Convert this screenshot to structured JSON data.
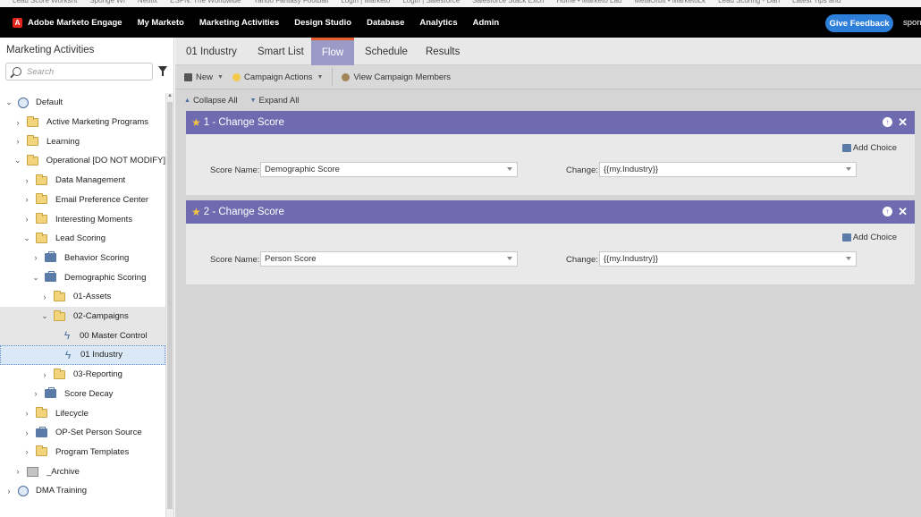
{
  "bookmarks": [
    "Lead Score Worksht",
    "Sponge WI",
    "Netflix",
    "ESPN: The Worldwide",
    "Yahoo Fantasy Football",
    "Login | Marketo",
    "Login | Salesforce",
    "Salesforce Stack Exch",
    "Home • Marketo Lau",
    "MetaOrbit • MarketoLk",
    "Lead Scoring - Dan",
    "Latest Tips and"
  ],
  "topnav": {
    "brand": "Adobe Marketo Engage",
    "links": [
      "My Marketo",
      "Marketing Activities",
      "Design Studio",
      "Database",
      "Analytics",
      "Admin"
    ],
    "feedback": "Give Feedback",
    "user": "spong"
  },
  "sidebar": {
    "title": "Marketing Activities",
    "search_placeholder": "Search",
    "tree": [
      {
        "label": "Default",
        "level": 0,
        "icon": "globe",
        "chev": "v"
      },
      {
        "label": "Active Marketing Programs",
        "level": 1,
        "icon": "folder",
        "chev": ">"
      },
      {
        "label": "Learning",
        "level": 1,
        "icon": "folder",
        "chev": ">"
      },
      {
        "label": "Operational [DO NOT MODIFY]",
        "level": 1,
        "icon": "folder",
        "chev": "v"
      },
      {
        "label": "Data Management",
        "level": 2,
        "icon": "folder",
        "chev": ">"
      },
      {
        "label": "Email Preference Center",
        "level": 2,
        "icon": "folder",
        "chev": ">"
      },
      {
        "label": "Interesting Moments",
        "level": 2,
        "icon": "folder",
        "chev": ">"
      },
      {
        "label": "Lead Scoring",
        "level": 2,
        "icon": "folder",
        "chev": "v"
      },
      {
        "label": "Behavior Scoring",
        "level": 3,
        "icon": "program",
        "chev": ">"
      },
      {
        "label": "Demographic Scoring",
        "level": 3,
        "icon": "program",
        "chev": "v"
      },
      {
        "label": "01-Assets",
        "level": 4,
        "icon": "folder",
        "chev": ">"
      },
      {
        "label": "02-Campaigns",
        "level": 4,
        "icon": "folder",
        "chev": "v",
        "state": "hl"
      },
      {
        "label": "00 Master Control",
        "level": 5,
        "icon": "bolt",
        "chev": "",
        "state": "hl"
      },
      {
        "label": "01 Industry",
        "level": 5,
        "icon": "bolt",
        "chev": "",
        "state": "sel"
      },
      {
        "label": "03-Reporting",
        "level": 4,
        "icon": "folder",
        "chev": ">"
      },
      {
        "label": "Score Decay",
        "level": 3,
        "icon": "program",
        "chev": ">"
      },
      {
        "label": "Lifecycle",
        "level": 2,
        "icon": "folder",
        "chev": ">"
      },
      {
        "label": "OP-Set Person Source",
        "level": 2,
        "icon": "program",
        "chev": ">"
      },
      {
        "label": "Program Templates",
        "level": 2,
        "icon": "folder",
        "chev": ">"
      },
      {
        "label": "_Archive",
        "level": 1,
        "icon": "archive",
        "chev": ">"
      },
      {
        "label": "DMA Training",
        "level": 0,
        "icon": "globe",
        "chev": ">"
      }
    ]
  },
  "tabs": [
    {
      "label": "01 Industry",
      "active": false
    },
    {
      "label": "Smart List",
      "active": false
    },
    {
      "label": "Flow",
      "active": true
    },
    {
      "label": "Schedule",
      "active": false
    },
    {
      "label": "Results",
      "active": false
    }
  ],
  "toolbar": {
    "new_label": "New",
    "campaign_actions_label": "Campaign Actions",
    "view_members_label": "View Campaign Members",
    "collapse_all": "Collapse All",
    "expand_all": "Expand All"
  },
  "flow_steps": [
    {
      "title": "1 - Change Score",
      "add_choice": "Add Choice",
      "score_name_label": "Score Name:",
      "score_name_value": "Demographic Score",
      "change_label": "Change:",
      "change_value": "{{my.Industry}}"
    },
    {
      "title": "2 - Change Score",
      "add_choice": "Add Choice",
      "score_name_label": "Score Name:",
      "score_name_value": "Person Score",
      "change_label": "Change:",
      "change_value": "{{my.Industry}}"
    }
  ],
  "colors": {
    "accent": "#6e6bb0",
    "tab_active": "#9c9ac7",
    "tab_border": "#e85d2f",
    "feedback": "#2e7fd9"
  }
}
